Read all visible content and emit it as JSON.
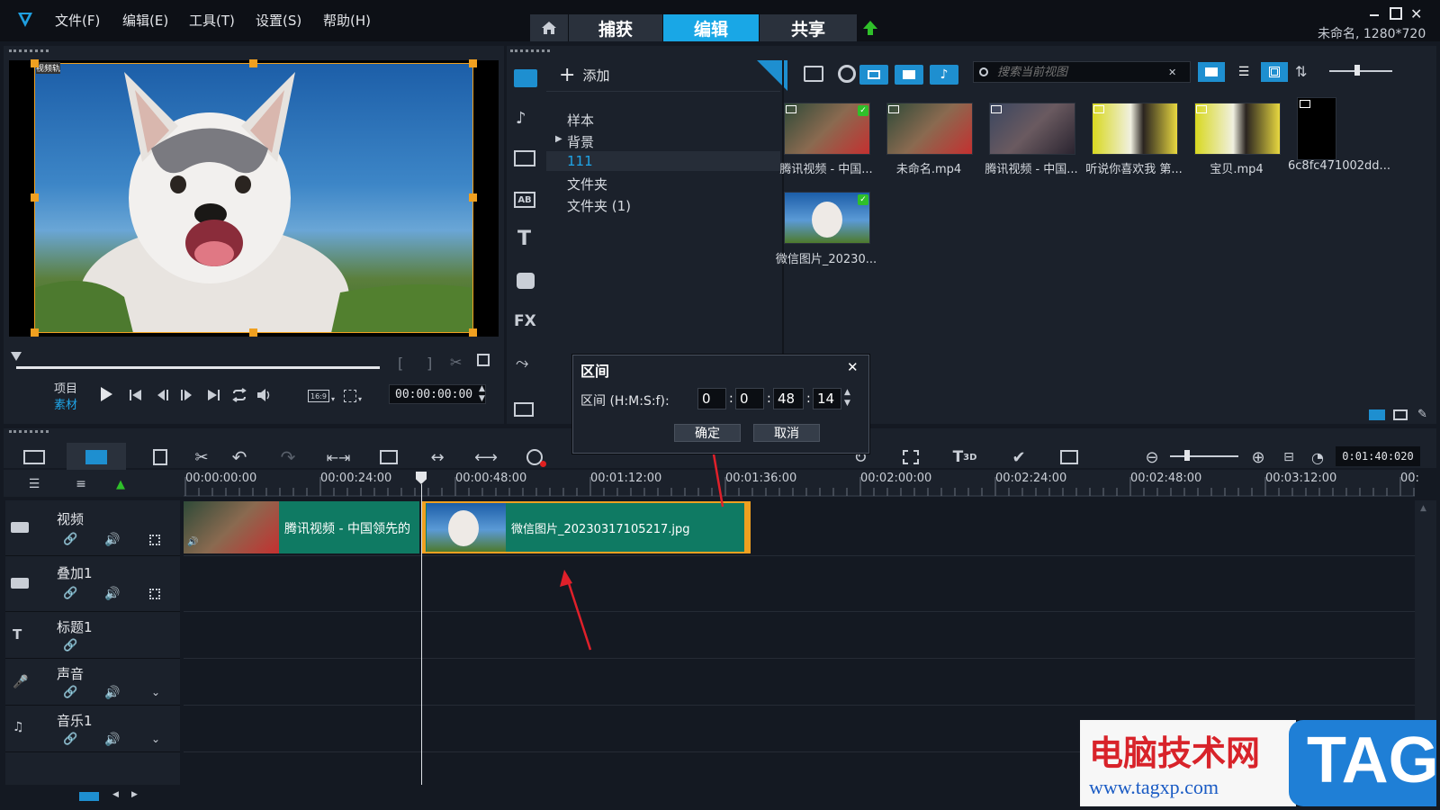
{
  "app": {
    "project_info": "未命名, 1280*720"
  },
  "menu": {
    "file": "文件(F)",
    "edit": "编辑(E)",
    "tools": "工具(T)",
    "settings": "设置(S)",
    "help": "帮助(H)"
  },
  "main_tabs": {
    "capture": "捕获",
    "edit": "编辑",
    "share": "共享"
  },
  "preview": {
    "overlay_label": "视频轨",
    "mode_project": "项目",
    "mode_clip": "素材",
    "aspect": "16:9",
    "timecode": "00:00:00:00"
  },
  "library": {
    "add_label": "添加",
    "folders": [
      "样本",
      "背景",
      "111",
      "文件夹",
      "文件夹 (1)"
    ],
    "search_placeholder": "搜索当前视图",
    "items": [
      {
        "label": "腾讯视频 - 中国...",
        "checked": true
      },
      {
        "label": "未命名.mp4",
        "checked": false
      },
      {
        "label": "腾讯视频 - 中国...",
        "checked": false
      },
      {
        "label": "听说你喜欢我 第...",
        "checked": false
      },
      {
        "label": "宝贝.mp4",
        "checked": false
      },
      {
        "label": "6c8fc471002dd...",
        "checked": false
      },
      {
        "label": "微信图片_20230...",
        "checked": true
      }
    ]
  },
  "dialog": {
    "title": "区间",
    "field_label": "区间 (H:M:S:f):",
    "h": "0",
    "m": "0",
    "s": "48",
    "f": "14",
    "ok": "确定",
    "cancel": "取消"
  },
  "timeline": {
    "total_duration": "0:01:40:020",
    "ruler": [
      "00:00:00:00",
      "00:00:24:00",
      "00:00:48:00",
      "00:01:12:00",
      "00:01:36:00",
      "00:02:00:00",
      "00:02:24:00",
      "00:02:48:00",
      "00:03:12:00",
      "00:"
    ],
    "tracks": [
      "视频",
      "叠加1",
      "标题1",
      "声音",
      "音乐1"
    ],
    "clips": [
      {
        "label": "腾讯视频 - 中国领先的"
      },
      {
        "label": "微信图片_20230317105217.jpg"
      }
    ]
  },
  "watermark": {
    "title": "电脑技术网",
    "url": "www.tagxp.com",
    "tag": "TAG"
  },
  "colors": {
    "accent": "#19a7e6",
    "clip": "#0f7a63",
    "highlight": "#f0a020"
  }
}
